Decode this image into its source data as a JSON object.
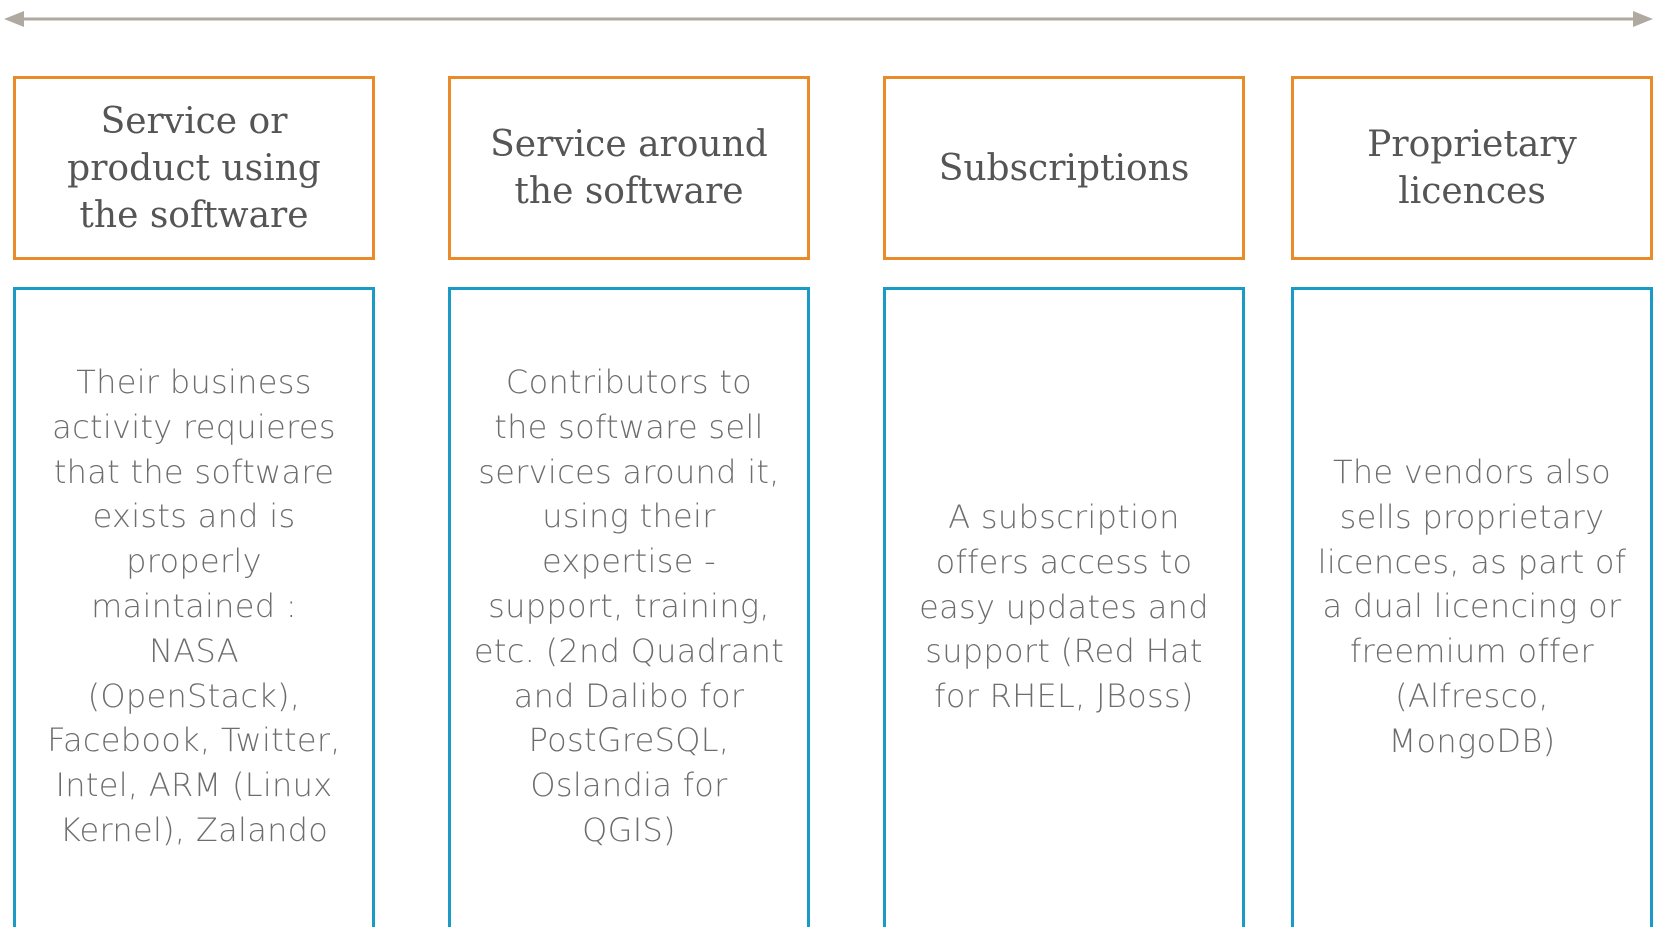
{
  "top_arrow": {
    "color": "#b0a9a2"
  },
  "columns": [
    {
      "heading": "Service or\nproduct using\nthe software",
      "description": "Their business\nactivity requieres\nthat the software\nexists and is\nproperly\nmaintained :\nNASA\n(OpenStack),\nFacebook, Twitter,\nIntel, ARM (Linux\nKernel), Zalando"
    },
    {
      "heading": "Service around\nthe software",
      "description": "Contributors to\nthe software sell\nservices around it,\nusing their\nexpertise  -\nsupport, training,\netc. (2nd Quadrant\nand Dalibo for\nPostGreSQL,\nOslandia for\nQGIS)"
    },
    {
      "heading": "Subscriptions",
      "description": "A subscription\noffers access to\neasy updates and\nsupport (Red Hat\nfor RHEL, JBoss)"
    },
    {
      "heading": "Proprietary\nlicences",
      "description": "The vendors also\nsells proprietary\nlicences, as part of\na dual licencing or\nfreemium offer\n(Alfresco,\nMongoDB)"
    }
  ],
  "colors": {
    "heading_border": "#e98a2b",
    "body_border": "#1a9bc6",
    "heading_text": "#555555",
    "body_text": "#6d6d6d"
  }
}
